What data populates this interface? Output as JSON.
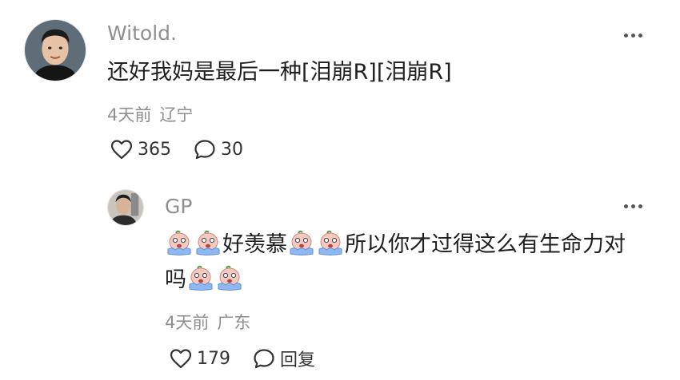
{
  "comment": {
    "username": "Witold.",
    "text": "还好我妈是最后一种[泪崩R][泪崩R]",
    "time": "4天前",
    "location": "辽宁",
    "likes": "365",
    "replies": "30",
    "icons": {
      "like": "heart-outline-icon",
      "reply": "speech-bubble-icon",
      "more": "more-dots-icon"
    }
  },
  "reply": {
    "username": "GP",
    "text_parts": [
      "好羡慕",
      "所以你才过得这么有生命力对",
      "吗"
    ],
    "emoji": "crying-tears-emoji",
    "time": "4天前",
    "location": "广东",
    "likes": "179",
    "reply_label": "回复"
  },
  "colors": {
    "muted": "#8f8f8f",
    "text": "#1f1f1f",
    "emoji_face": "#f6c8bf",
    "emoji_tears": "#8fb8f0"
  }
}
